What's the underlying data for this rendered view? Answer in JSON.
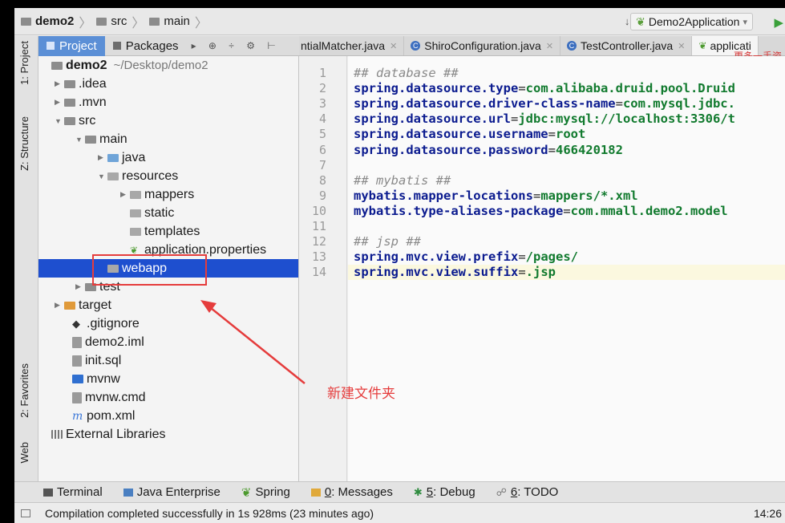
{
  "navbar": {
    "crumbs": [
      "demo2",
      "src",
      "main"
    ],
    "run_config": "Demo2Application",
    "run_config_arrow": "▾",
    "sort_icon": "↓⁞",
    "play_icon": "▶"
  },
  "left_strip": {
    "project_tab": "1: Project",
    "structure_tab": "Z: Structure",
    "favorites_tab": "2: Favorites",
    "web_tab": "Web"
  },
  "tool_header": {
    "project_tab": "Project",
    "packages_tab": "Packages",
    "icons": "▸ ⊕ ÷ ⚙ ⊢"
  },
  "tree": {
    "root": {
      "name": "demo2",
      "path": "~/Desktop/demo2"
    },
    "items": [
      {
        "label": ".idea"
      },
      {
        "label": ".mvn"
      },
      {
        "label": "src"
      },
      {
        "label": "main"
      },
      {
        "label": "java"
      },
      {
        "label": "resources"
      },
      {
        "label": "mappers"
      },
      {
        "label": "static"
      },
      {
        "label": "templates"
      },
      {
        "label": "application.properties"
      },
      {
        "label": "webapp"
      },
      {
        "label": "test"
      },
      {
        "label": "target"
      },
      {
        "label": ".gitignore"
      },
      {
        "label": "demo2.iml"
      },
      {
        "label": "init.sql"
      },
      {
        "label": "mvnw"
      },
      {
        "label": "mvnw.cmd"
      },
      {
        "label": "pom.xml"
      },
      {
        "label": "External Libraries"
      }
    ]
  },
  "editor_tabs": [
    {
      "label": "ntialMatcher.java"
    },
    {
      "label": "ShiroConfiguration.java"
    },
    {
      "label": "TestController.java"
    },
    {
      "label": "applicati"
    }
  ],
  "watermark": "更多一手资",
  "code": {
    "line_numbers": [
      "1",
      "2",
      "3",
      "4",
      "5",
      "6",
      "7",
      "8",
      "9",
      "10",
      "11",
      "12",
      "13",
      "14"
    ],
    "lines": [
      {
        "comment": "## database ##"
      },
      {
        "key": "spring.datasource.type",
        "value": "com.alibaba.druid.pool.Druid"
      },
      {
        "key": "spring.datasource.driver-class-name",
        "value": "com.mysql.jdbc."
      },
      {
        "key": "spring.datasource.url",
        "value": "jdbc:mysql://localhost:3306/t"
      },
      {
        "key": "spring.datasource.username",
        "value": "root"
      },
      {
        "key": "spring.datasource.password",
        "value": "466420182"
      },
      {},
      {
        "comment": "## mybatis ##"
      },
      {
        "key": "mybatis.mapper-locations",
        "value": "mappers/*.xml"
      },
      {
        "key": "mybatis.type-aliases-package",
        "value": "com.mmall.demo2.model"
      },
      {},
      {
        "comment": "## jsp ##"
      },
      {
        "key": "spring.mvc.view.prefix",
        "value": "/pages/"
      },
      {
        "key": "spring.mvc.view.suffix",
        "value": ".jsp"
      }
    ],
    "equals": "="
  },
  "annotation": "新建文件夹",
  "bottom_tabs": [
    {
      "label": "Terminal"
    },
    {
      "label": "Java Enterprise"
    },
    {
      "label": "Spring"
    },
    {
      "mnemonic": "0",
      "label": ": Messages"
    },
    {
      "mnemonic": "5",
      "label": ": Debug"
    },
    {
      "mnemonic": "6",
      "label": ": TODO"
    }
  ],
  "status": {
    "message": "Compilation completed successfully in 1s 928ms (23 minutes ago)",
    "time": "14:26"
  },
  "colors": {
    "selection": "#1e4fcf",
    "annotation_red": "#e53c3c",
    "key_blue": "#0b1b8f",
    "value_green": "#117a2e"
  }
}
